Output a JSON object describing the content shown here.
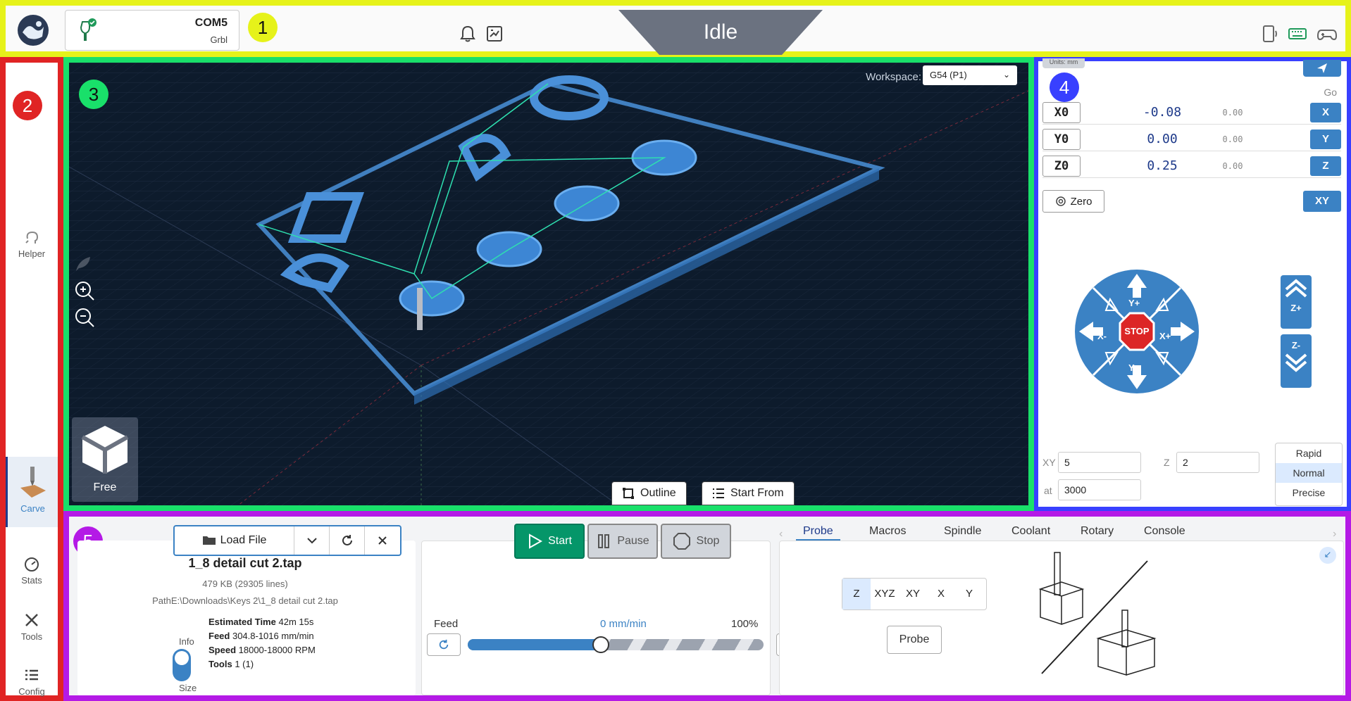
{
  "topbar": {
    "port": "COM5",
    "firmware": "Grbl",
    "status": "Idle",
    "badge": "1"
  },
  "nav": {
    "badge": "2",
    "items": [
      {
        "label": "Helper",
        "icon": "helper-icon"
      },
      {
        "label": "Carve",
        "icon": "carve-icon"
      },
      {
        "label": "Stats",
        "icon": "stats-icon"
      },
      {
        "label": "Tools",
        "icon": "tools-icon"
      },
      {
        "label": "Config",
        "icon": "config-icon"
      }
    ]
  },
  "viz": {
    "badge": "3",
    "workspace_label": "Workspace:",
    "workspace_value": "G54 (P1)",
    "camera_label": "Free",
    "outline_label": "Outline",
    "start_from_label": "Start From"
  },
  "dro": {
    "badge": "4",
    "units": "Units: mm",
    "go_label": "Go",
    "rows": [
      {
        "axis": "X0",
        "value": "-0.08",
        "machine": "0.00",
        "go": "X"
      },
      {
        "axis": "Y0",
        "value": "0.00",
        "machine": "0.00",
        "go": "Y"
      },
      {
        "axis": "Z0",
        "value": "0.25",
        "machine": "0.00",
        "go": "Z"
      }
    ],
    "zero_label": "Zero",
    "xy_label": "XY",
    "jog": {
      "up": "Y+",
      "down": "Y-",
      "left": "X-",
      "right": "X+",
      "stop": "STOP",
      "zplus": "Z+",
      "zminus": "Z-"
    },
    "inputs": {
      "xy_label": "XY",
      "xy_value": "5",
      "z_label": "Z",
      "z_value": "2",
      "at_label": "at",
      "at_value": "3000"
    },
    "speeds": [
      "Rapid",
      "Normal",
      "Precise"
    ],
    "speed_active": "Normal"
  },
  "bottom": {
    "badge": "5",
    "load_file_label": "Load File",
    "file_name": "1_8 detail cut 2.tap",
    "file_size": "479 KB (29305 lines)",
    "file_path": "PathE:\\Downloads\\Keys 2\\1_8 detail cut 2.tap",
    "info": {
      "est_time_label": "Estimated Time",
      "est_time": "42m 15s",
      "feed_label": "Feed",
      "feed": "304.8-1016 mm/min",
      "speed_label": "Speed",
      "speed": "18000-18000 RPM",
      "tools_label": "Tools",
      "tools": "1 (1)"
    },
    "toggle_top": "Info",
    "toggle_bottom": "Size",
    "start_label": "Start",
    "pause_label": "Pause",
    "stop_label": "Stop",
    "feed_label": "Feed",
    "feed_rate": "0 mm/min",
    "feed_override": "100%",
    "feed_fill": 0.45,
    "tabs": [
      "Probe",
      "Macros",
      "Spindle",
      "Coolant",
      "Rotary",
      "Console"
    ],
    "active_tab": "Probe",
    "probe_axes": [
      "Z",
      "XYZ",
      "XY",
      "X",
      "Y"
    ],
    "probe_active": "Z",
    "probe_label": "Probe"
  },
  "colors": {
    "accent": "#3b82c4",
    "start_green": "#059669",
    "stop_red": "#dc2626"
  }
}
